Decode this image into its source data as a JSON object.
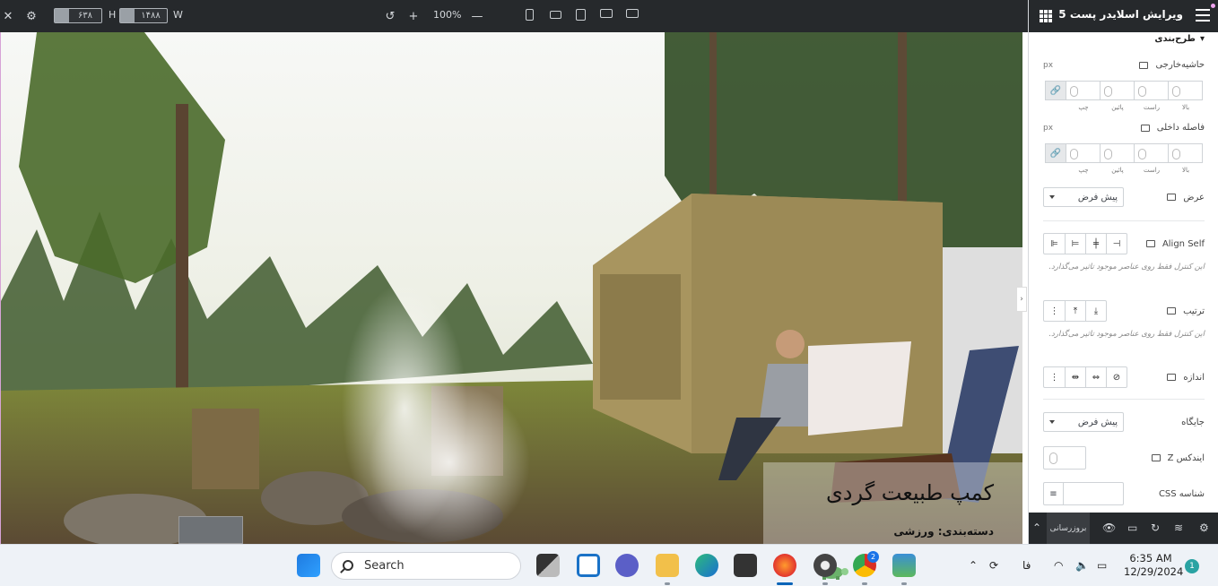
{
  "toolbar": {
    "width_label": "W",
    "height_label": "H",
    "width_value": "۱۴۸۸",
    "height_value": "۶۳۸",
    "zoom": "100%"
  },
  "slide": {
    "title": "کمپ طبیعت گردی",
    "category": "دسته‌بندی: ورزشی"
  },
  "panel": {
    "title": "ویرایش اسلایدر پست 5",
    "section_layout": "طرح‌بندی",
    "margin_label": "حاشیه‌خارجی",
    "padding_label": "فاصله داخلی",
    "unit": "px",
    "dir_top": "بالا",
    "dir_right": "راست",
    "dir_bottom": "پائین",
    "dir_left": "چپ",
    "width_label": "عرض",
    "width_value": "پیش فرض",
    "align_self_label": "Align Self",
    "align_note": "این کنترل فقط روی عناصر موجود تاثیر می‌گذارد.",
    "order_label": "ترتیب",
    "order_note": "این کنترل فقط روی عناصر موجود تاثیر می‌گذارد.",
    "size_label": "اندازه",
    "position_label": "جایگاه",
    "position_value": "پیش فرض",
    "zindex_label": "ایندکس Z",
    "css_id_label": "شناسه CSS",
    "update_button": "بروزرسانی"
  },
  "taskbar": {
    "search_placeholder": "Search",
    "language": "فا",
    "time": "6:35 AM",
    "date": "12/29/2024",
    "notification_count": "1",
    "chrome_badge": "2"
  },
  "colors": {
    "toolbar_bg": "#26292c",
    "panel_bg": "#ffffff",
    "taskbar_bg": "#eef2f7",
    "accent": "#0a64b8"
  }
}
